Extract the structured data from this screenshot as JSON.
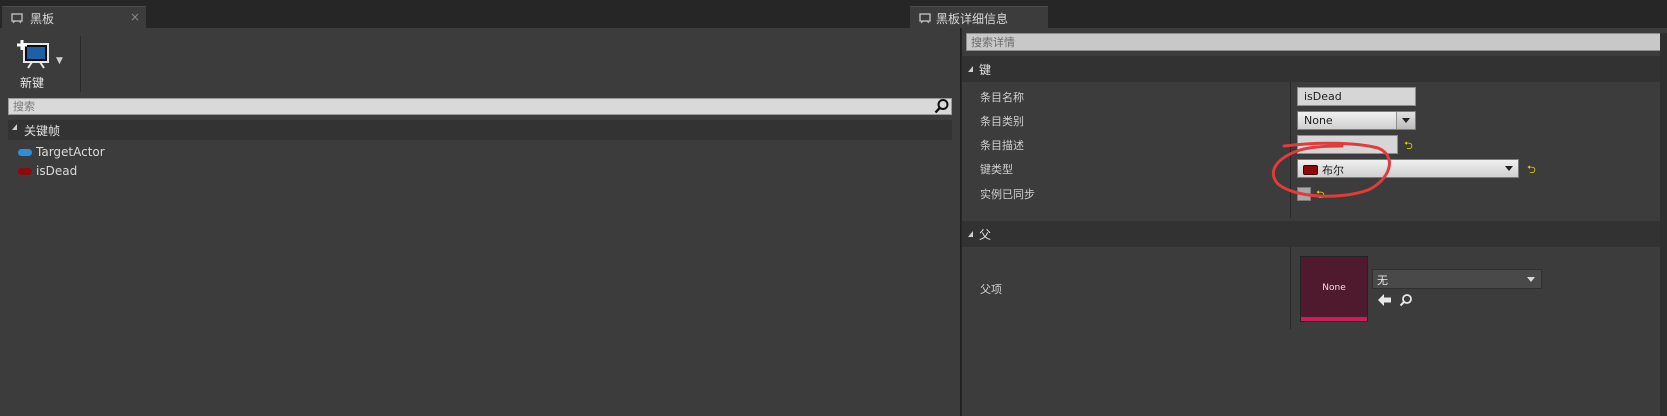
{
  "tabs": {
    "left": {
      "title": "黑板",
      "close": "×"
    },
    "right": {
      "title": "黑板详细信息"
    }
  },
  "toolbar": {
    "new_key_label": "新键"
  },
  "left_panel": {
    "search_placeholder": "搜索",
    "category": "关键帧",
    "entries": [
      {
        "name": "TargetActor",
        "color": "#2e8fd8"
      },
      {
        "name": "isDead",
        "color": "#8c0a0a"
      }
    ]
  },
  "right_panel": {
    "search_placeholder": "搜索详情",
    "key_section": {
      "title": "键",
      "entry_name_label": "条目名称",
      "entry_name_value": "isDead",
      "entry_category_label": "条目类别",
      "entry_category_value": "None",
      "entry_desc_label": "条目描述",
      "entry_desc_value": "",
      "key_type_label": "键类型",
      "key_type_value": "布尔",
      "key_type_color": "#8c0a0a",
      "instance_synced_label": "实例已同步",
      "instance_synced": false
    },
    "parent_section": {
      "title": "父",
      "parent_label": "父项",
      "thumbnail_text": "None",
      "parent_value": "无"
    }
  },
  "annotation_color": "#e23b3b"
}
